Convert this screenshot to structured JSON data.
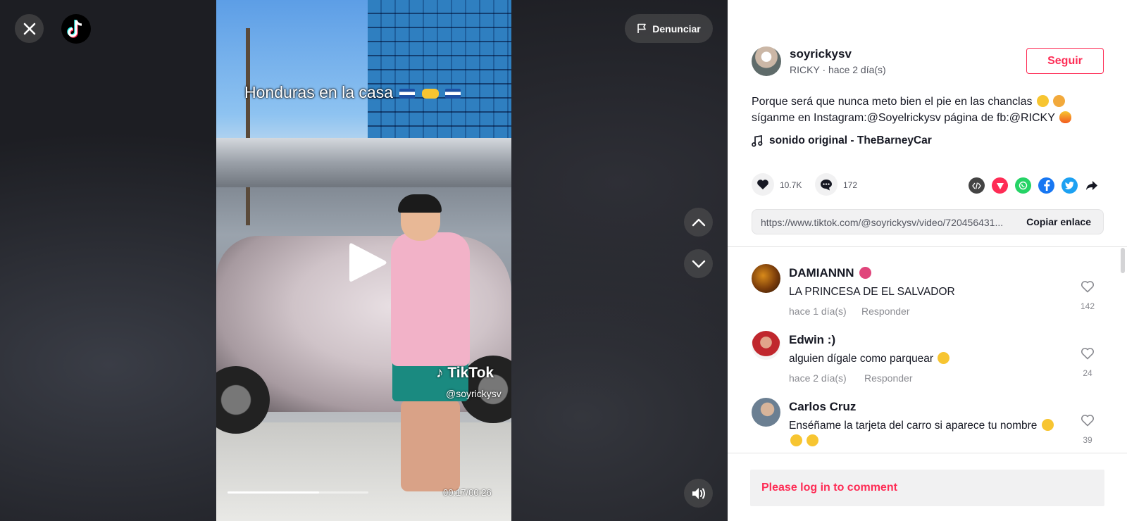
{
  "colors": {
    "accent": "#fe2c55",
    "text": "#161823",
    "muted": "#8a8b91"
  },
  "header": {
    "report_label": "Denunciar"
  },
  "video": {
    "caption": "Honduras en la casa",
    "watermark_brand": "TikTok",
    "watermark_user": "@soyrickysv",
    "time": "00:17/00:26",
    "progress": 0.65
  },
  "post": {
    "username": "soyrickysv",
    "nickname": "RICKY",
    "meta_separator": "·",
    "posted": "hace 2 día(s)",
    "follow_label": "Seguir",
    "description_line1": "Porque será que nunca meto bien el pie en las chanclas",
    "description_line2": "síganme en Instagram:@Soyelrickysv página de fb:@RICKY",
    "sound": "sonido original - TheBarneyCar",
    "likes": "10.7K",
    "comments": "172",
    "link": "https://www.tiktok.com/@soyrickysv/video/720456431...",
    "copy_label": "Copiar enlace"
  },
  "share_icons": [
    "embed-icon",
    "send-icon",
    "whatsapp-icon",
    "facebook-icon",
    "twitter-icon",
    "share-arrow-icon"
  ],
  "comments": [
    {
      "name": "DAMIANNN",
      "text": "LA PRINCESA DE EL SALVADOR",
      "time": "hace 1 día(s)",
      "reply": "Responder",
      "likes": "142"
    },
    {
      "name": "Edwin :)",
      "text": "alguien dígale como parquear",
      "time": "hace 2 día(s)",
      "reply": "Responder",
      "likes": "24"
    },
    {
      "name": "Carlos Cruz",
      "text": "Enséñame la tarjeta del carro si aparece tu nombre",
      "time": "",
      "reply": "",
      "likes": "39"
    }
  ],
  "login_prompt": "Please log in to comment"
}
